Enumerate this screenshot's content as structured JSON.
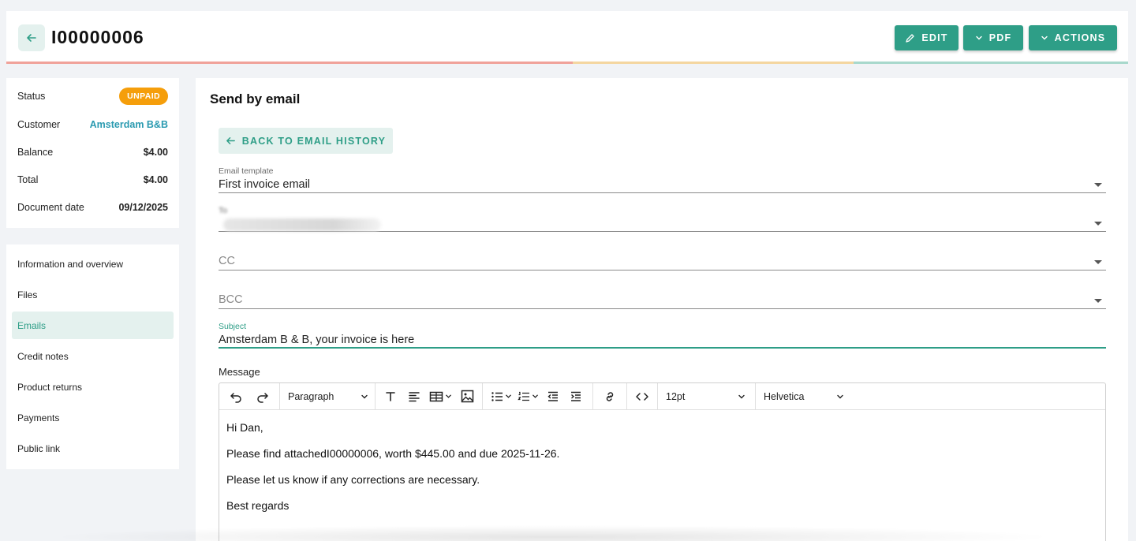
{
  "header": {
    "title": "I00000006",
    "buttons": {
      "edit": "EDIT",
      "pdf": "PDF",
      "actions": "ACTIONS"
    },
    "colors": {
      "accent": "#2e9e87",
      "progress": [
        "#f0a29a",
        "#f4d6a0",
        "#a8d8cc"
      ]
    }
  },
  "info": {
    "status_label": "Status",
    "status_value": "UNPAID",
    "customer_label": "Customer",
    "customer_value": "Amsterdam B&B",
    "balance_label": "Balance",
    "balance_value": "$4.00",
    "total_label": "Total",
    "total_value": "$4.00",
    "date_label": "Document date",
    "date_value": "09/12/2025"
  },
  "nav": {
    "items": [
      {
        "label": "Information and overview"
      },
      {
        "label": "Files"
      },
      {
        "label": "Emails"
      },
      {
        "label": "Credit notes"
      },
      {
        "label": "Product returns"
      },
      {
        "label": "Payments"
      },
      {
        "label": "Public link"
      }
    ]
  },
  "email": {
    "section_title": "Send by email",
    "back_button": "BACK TO EMAIL HISTORY",
    "template_label": "Email template",
    "template_value": "First invoice email",
    "to_label": "To",
    "cc_placeholder": "CC",
    "bcc_placeholder": "BCC",
    "subject_label": "Subject",
    "subject_value": "Amsterdam B & B, your invoice is here",
    "message_label": "Message"
  },
  "editor": {
    "block_format": "Paragraph",
    "font_size": "12pt",
    "font_family": "Helvetica",
    "body": [
      "Hi Dan,",
      "Please find attachedI00000006, worth $445.00 and due 2025-11-26.",
      "Please let us know if any corrections are necessary.",
      "Best regards"
    ]
  }
}
